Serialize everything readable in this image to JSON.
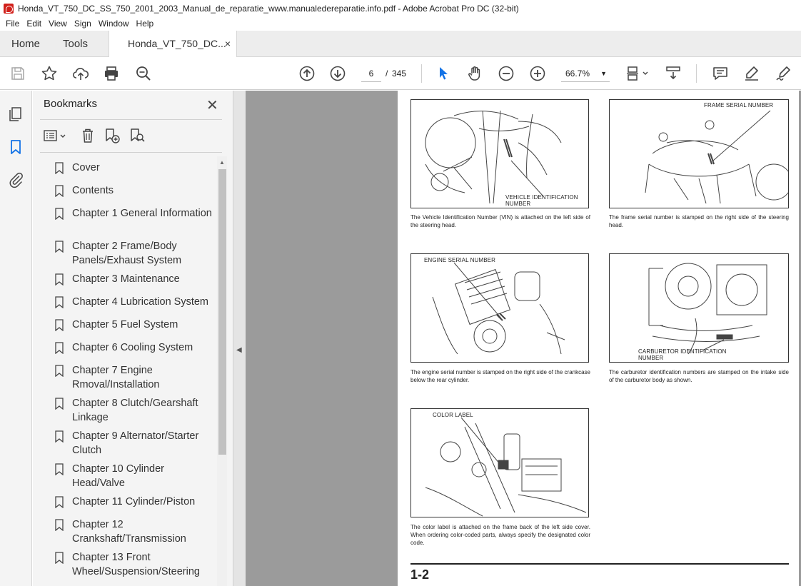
{
  "window": {
    "title": "Honda_VT_750_DC_SS_750_2001_2003_Manual_de_reparatie_www.manualedereparatie.info.pdf - Adobe Acrobat Pro DC (32-bit)"
  },
  "menu": [
    "File",
    "Edit",
    "View",
    "Sign",
    "Window",
    "Help"
  ],
  "tabs": {
    "home": "Home",
    "tools": "Tools",
    "document": "Honda_VT_750_DC...",
    "close": "×"
  },
  "toolbar": {
    "current_page": "6",
    "page_separator": "/",
    "total_pages": "345",
    "zoom": "66.7%"
  },
  "bookmarks": {
    "title": "Bookmarks",
    "close": "✕",
    "items": [
      "Cover",
      "Contents",
      "Chapter 1 General Information",
      "Chapter 2 Frame/Body Panels/Exhaust System",
      "Chapter 3 Maintenance",
      "Chapter 4 Lubrication System",
      "Chapter 5 Fuel System",
      "Chapter 6 Cooling System",
      "Chapter 7 Engine Rmoval/Installation",
      "Chapter 8 Clutch/Gearshaft Linkage",
      "Chapter 9 Alternator/Starter Clutch",
      "Chapter 10 Cylinder Head/Valve",
      "Chapter 11 Cylinder/Piston",
      "Chapter 12 Crankshaft/Transmission",
      "Chapter 13 Front Wheel/Suspension/Steering"
    ]
  },
  "page": {
    "figures": {
      "vin_label": "VEHICLE IDENTIFICATION NUMBER",
      "frame_label": "FRAME SERIAL NUMBER",
      "engine_label": "ENGINE SERIAL NUMBER",
      "carb_label": "CARBURETOR IDENTIFICATION NUMBER",
      "color_label": "COLOR LABEL"
    },
    "captions": {
      "vin": "The Vehicle Identification Number (VIN) is attached on the left side of the steering head.",
      "frame": "The frame serial number is stamped on the right side of the steering head.",
      "engine": "The engine serial number is stamped on the right side of the crankcase below the rear cylinder.",
      "carb": "The carburetor identification numbers are stamped on the intake side of the carburetor body as shown.",
      "color": "The color label is attached on the frame back of the left side cover. When ordering color-coded parts, always specify the designated color code."
    },
    "page_number": "1-2"
  }
}
